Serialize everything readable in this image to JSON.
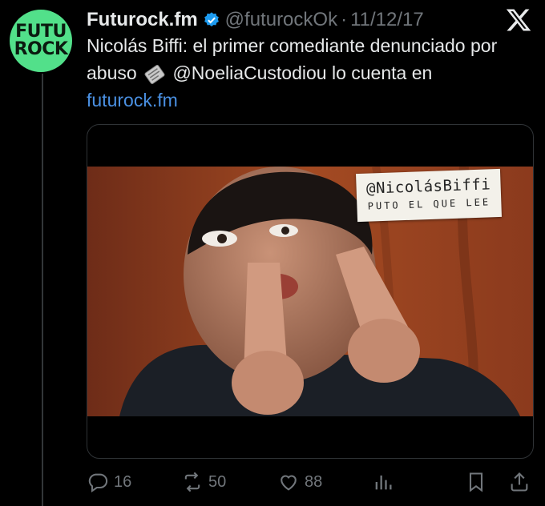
{
  "avatar": {
    "line1": "FUTU",
    "line2": "ROCK"
  },
  "tweet": {
    "author_name": "Futurock.fm",
    "handle": "@futurockOk",
    "separator": "·",
    "date": "11/12/17",
    "text_part1": "Nicolás Biffi: el primer comediante denunciado por abuso",
    "text_part2": "@NoeliaCustodiou lo cuenta en",
    "link": "futurock.fm"
  },
  "media": {
    "sign_line1": "@NicolásBiffi",
    "sign_line2": "PUTO EL QUE LEE"
  },
  "actions": {
    "replies": "16",
    "retweets": "50",
    "likes": "88"
  },
  "colors": {
    "accent": "#1d9bf0",
    "link": "#4a90e2",
    "avatar_bg": "#52e08a"
  },
  "icons": [
    "verified-badge-icon",
    "x-logo-icon",
    "newspaper-icon",
    "reply-icon",
    "retweet-icon",
    "like-icon",
    "views-icon",
    "bookmark-icon",
    "share-icon"
  ]
}
